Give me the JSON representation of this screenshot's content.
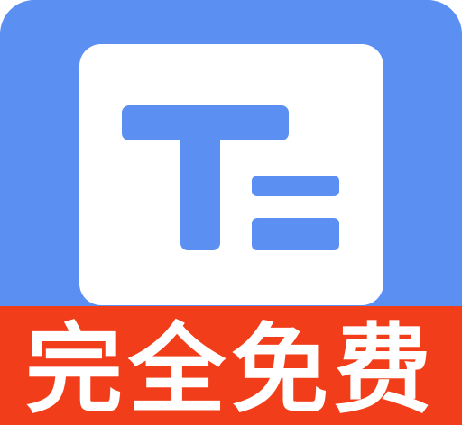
{
  "app_icon": {
    "icon": "t-lines-logo-icon",
    "banner_text": "完全免费"
  },
  "colors": {
    "background_blue": "#5b8ff2",
    "card_white": "#ffffff",
    "mark_blue": "#5b8ff2",
    "banner_red": "#f23d1a",
    "banner_text": "#ffffff"
  }
}
